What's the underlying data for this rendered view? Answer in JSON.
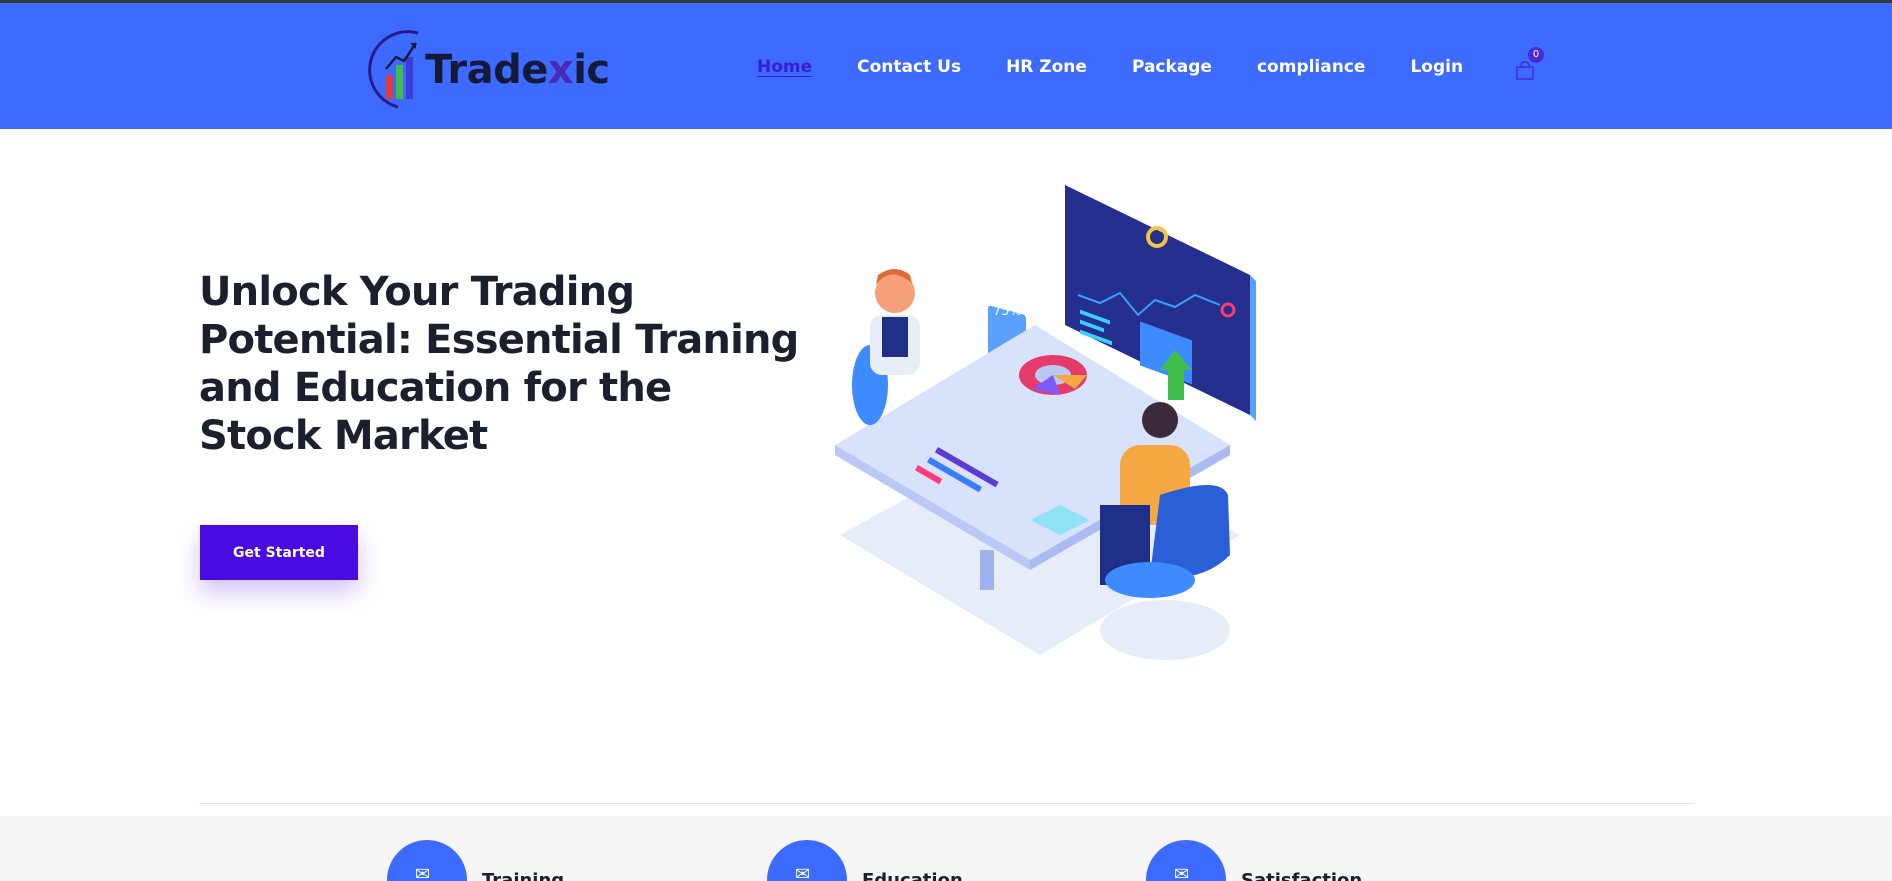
{
  "brand": {
    "name_prefix": "Trade",
    "name_x": "x",
    "name_suffix": "ic",
    "primary_color": "#3d6bff",
    "accent_color": "#4a0be0"
  },
  "nav": {
    "items": [
      {
        "label": "Home",
        "active": true
      },
      {
        "label": "Contact Us",
        "active": false
      },
      {
        "label": "HR Zone",
        "active": false
      },
      {
        "label": "Package",
        "active": false
      },
      {
        "label": "compliance",
        "active": false
      },
      {
        "label": "Login",
        "active": false
      }
    ],
    "cart_icon": "shopping-bag-icon",
    "cart_count": "0"
  },
  "hero": {
    "title": "Unlock Your Trading Potential: Essential Traning and Education for the Stock Market",
    "cta_label": "Get Started",
    "illustration_badge": "75%"
  },
  "features": [
    {
      "icon": "envelope-icon",
      "label": "Training"
    },
    {
      "icon": "envelope-icon",
      "label": "Education"
    },
    {
      "icon": "envelope-icon",
      "label": "Satisfaction"
    }
  ]
}
